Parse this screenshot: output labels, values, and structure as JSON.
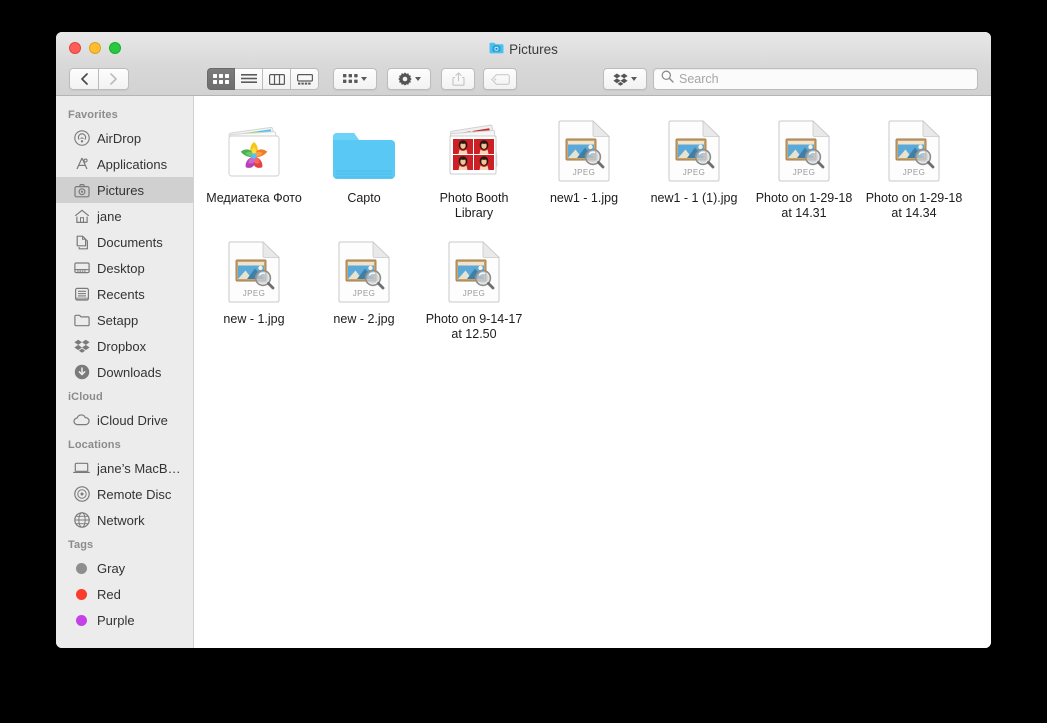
{
  "window": {
    "title": "Pictures",
    "title_icon": "pictures-folder-icon"
  },
  "traffic_lights": {
    "close": "close-window-button",
    "minimize": "minimize-window-button",
    "zoom": "zoom-window-button"
  },
  "toolbar": {
    "back_label": "Back",
    "forward_label": "Forward",
    "view_modes": [
      {
        "name": "icon-view",
        "label": "Icon View",
        "active": true
      },
      {
        "name": "list-view",
        "label": "List View",
        "active": false
      },
      {
        "name": "column-view",
        "label": "Column View",
        "active": false
      },
      {
        "name": "gallery-view",
        "label": "Gallery View",
        "active": false
      }
    ],
    "arrange_label": "Arrange By",
    "action_label": "Action",
    "share_label": "Share",
    "tag_label": "Edit Tags",
    "dropbox_label": "Dropbox"
  },
  "search": {
    "placeholder": "Search",
    "value": ""
  },
  "sidebar": {
    "sections": [
      {
        "header": "Favorites",
        "items": [
          {
            "label": "AirDrop",
            "icon": "airdrop-icon",
            "selected": false
          },
          {
            "label": "Applications",
            "icon": "applications-icon",
            "selected": false
          },
          {
            "label": "Pictures",
            "icon": "pictures-icon",
            "selected": true
          },
          {
            "label": "jane",
            "icon": "home-icon",
            "selected": false
          },
          {
            "label": "Documents",
            "icon": "documents-icon",
            "selected": false
          },
          {
            "label": "Desktop",
            "icon": "desktop-icon",
            "selected": false
          },
          {
            "label": "Recents",
            "icon": "recents-icon",
            "selected": false
          },
          {
            "label": "Setapp",
            "icon": "folder-icon",
            "selected": false
          },
          {
            "label": "Dropbox",
            "icon": "dropbox-icon",
            "selected": false
          },
          {
            "label": "Downloads",
            "icon": "downloads-icon",
            "selected": false
          }
        ]
      },
      {
        "header": "iCloud",
        "items": [
          {
            "label": "iCloud Drive",
            "icon": "icloud-icon",
            "selected": false
          }
        ]
      },
      {
        "header": "Locations",
        "items": [
          {
            "label": "jane’s MacB…",
            "icon": "laptop-icon",
            "selected": false
          },
          {
            "label": "Remote Disc",
            "icon": "remote-disc-icon",
            "selected": false
          },
          {
            "label": "Network",
            "icon": "network-icon",
            "selected": false
          }
        ]
      },
      {
        "header": "Tags",
        "items": [
          {
            "label": "Gray",
            "icon": "tag-dot-icon",
            "color": "#8e8e8e",
            "selected": false
          },
          {
            "label": "Red",
            "icon": "tag-dot-icon",
            "color": "#fc3b2f",
            "selected": false
          },
          {
            "label": "Purple",
            "icon": "tag-dot-icon",
            "color": "#c540e8",
            "selected": false
          }
        ]
      }
    ]
  },
  "files": [
    {
      "name": "Медиатека Фото",
      "type": "photos-library"
    },
    {
      "name": "Capto",
      "type": "folder"
    },
    {
      "name": "Photo Booth Library",
      "type": "photo-booth-library"
    },
    {
      "name": "new1 - 1.jpg",
      "type": "jpeg",
      "badge": "JPEG"
    },
    {
      "name": "new1 - 1 (1).jpg",
      "type": "jpeg",
      "badge": "JPEG"
    },
    {
      "name": "Photo on 1-29-18 at 14.31",
      "type": "jpeg",
      "badge": "JPEG"
    },
    {
      "name": "Photo on 1-29-18 at 14.34",
      "type": "jpeg",
      "badge": "JPEG"
    },
    {
      "name": "new - 1.jpg",
      "type": "jpeg",
      "badge": "JPEG"
    },
    {
      "name": "new - 2.jpg",
      "type": "jpeg",
      "badge": "JPEG"
    },
    {
      "name": "Photo on 9-14-17 at 12.50",
      "type": "jpeg",
      "badge": "JPEG"
    }
  ],
  "colors": {
    "selection": "#d0d0d0",
    "sidebar_bg": "#ececec",
    "folder_blue": "#5ac8f5",
    "red_tag": "#fc3b2f",
    "purple_tag": "#c540e8",
    "gray_tag": "#8e8e8e"
  }
}
